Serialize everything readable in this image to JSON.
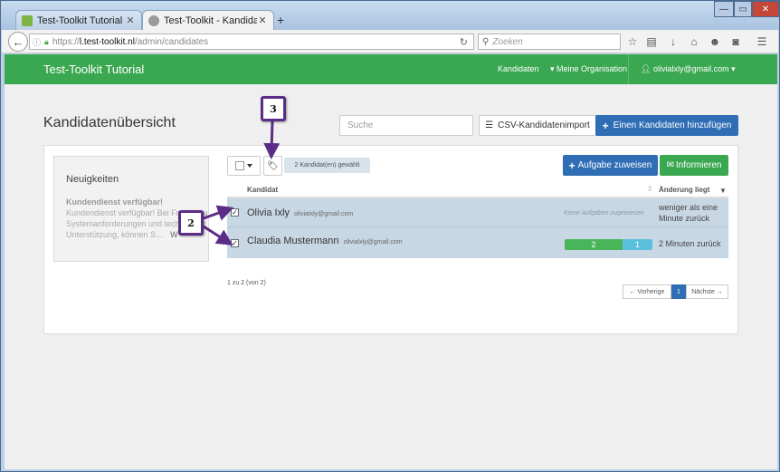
{
  "browser": {
    "tabs": [
      {
        "label": "Test-Toolkit Tutorial > Ixly",
        "favicon_color": "#7cb342",
        "active": false
      },
      {
        "label": "Test-Toolkit - Kandidatenü...",
        "favicon_color": "#9a9a9a",
        "active": true
      }
    ],
    "new_tab_label": "+",
    "url": {
      "scheme": "https://",
      "host": "l.test-toolkit.nl",
      "path": "/admin/candidates"
    },
    "search_placeholder": "Zoeken",
    "window_controls": {
      "minimize": "—",
      "maximize": "▭",
      "close": "✕"
    }
  },
  "navbar": {
    "brand": "Test-Toolkit Tutorial",
    "links": [
      "Kandidaten",
      "▾ Meine Organisation"
    ],
    "user": "olivialxly@gmail.com ▾",
    "color": "#3aa751"
  },
  "page": {
    "title": "Kandidatenübersicht",
    "search_placeholder": "Suche",
    "csv_import_label": "CSV-Kandidatenimport",
    "add_candidate_label": "Einen Kandidaten hinzufügen"
  },
  "news": {
    "title": "Neuigkeiten",
    "headline": "Kundendienst verfügbar!",
    "body": "Kundendienst verfügbar! Bei Fragen zu Systemanforderungen und technischer Unterstützung, können S...",
    "more": "W"
  },
  "toolbar": {
    "selected_badge": "2 Kandidat(en) gewählt",
    "assign_task_label": "Aufgabe zuweisen",
    "inform_label": "Informieren"
  },
  "table": {
    "columns": [
      "Kandidat",
      "Änderung liegt"
    ],
    "rows": [
      {
        "checked": "✓",
        "name": "Olivia Ixly",
        "email": "olivialxly@gmail.com",
        "tasks": "Keine Aufgaben zugewiesen",
        "changed": "weniger als eine Minute zurück"
      },
      {
        "checked": "✓",
        "name": "Claudia Mustermann",
        "email": "olivialxly@gmail.com",
        "progress_done": "2",
        "progress_open": "1",
        "changed": "2 Minuten zurück"
      }
    ],
    "count_text": "1 zu 2 (von 2)"
  },
  "pagination": {
    "prev": "← Vorherige",
    "current": "1",
    "next": "Nächste →"
  },
  "callouts": {
    "tag": "3",
    "checkboxes": "2"
  },
  "icons": {
    "back": "back-arrow-icon",
    "lock": "lock-icon",
    "tag": "tag-icon",
    "list": "list-icon",
    "plus": "plus-icon",
    "mail": "envelope-icon",
    "user": "user-icon"
  }
}
